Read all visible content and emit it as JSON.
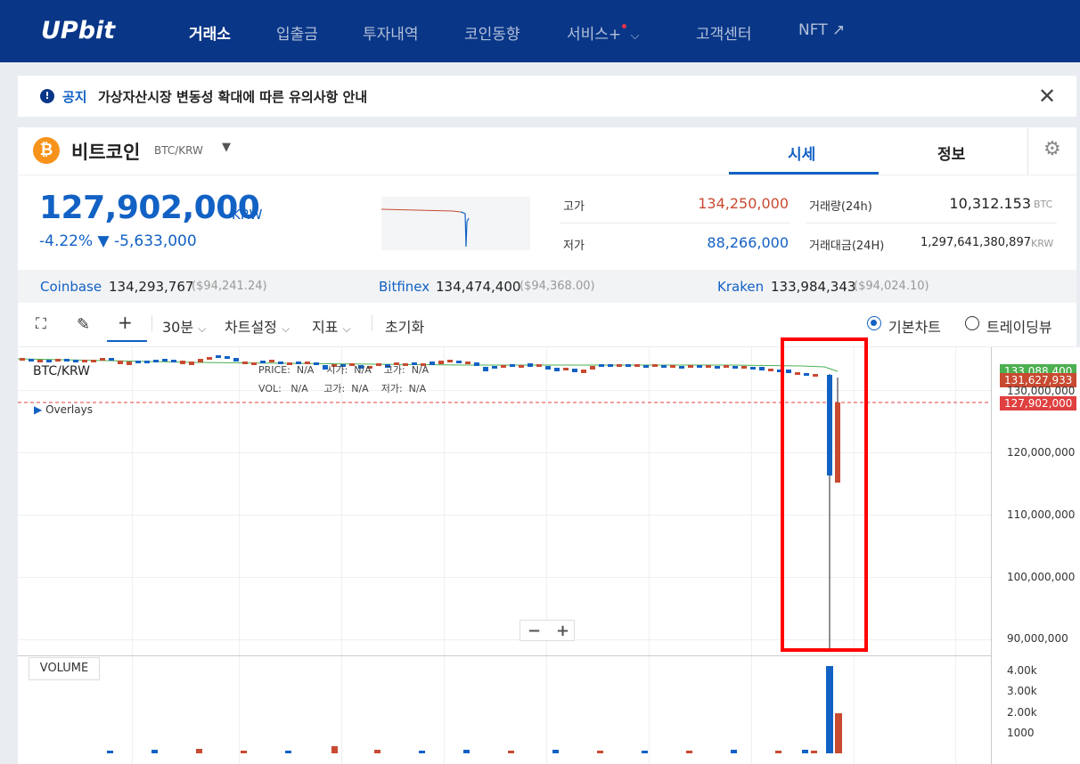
{
  "nav": {
    "logo": "UPbit",
    "items": [
      "거래소",
      "입출금",
      "투자내역",
      "코인동향",
      "서비스+",
      "고객센터",
      "NFT ↗"
    ]
  },
  "notice": {
    "label": "공지",
    "text": "가상자산시장 변동성 확대에 따른 유의사항 안내",
    "close": "✕"
  },
  "coin": {
    "name": "비트코인",
    "pair": "BTC/KRW",
    "tabs": [
      "시세",
      "정보"
    ],
    "price": "127,902,000",
    "unit": "KRW",
    "change_pct": "-4.22%",
    "change_amt": "▼ -5,633,000",
    "stats": {
      "high_label": "고가",
      "high_value": "134,250,000",
      "low_label": "저가",
      "low_value": "88,266,000",
      "vol_label": "거래량(24h)",
      "vol_value": "10,312.153",
      "vol_unit": "BTC",
      "amt_label": "거래대금(24H)",
      "amt_value": "1,297,641,380,897",
      "amt_unit": "KRW"
    }
  },
  "exchanges": [
    {
      "name": "Coinbase",
      "value": "134,293,767",
      "usd": "($94,241.24)"
    },
    {
      "name": "Bitfinex",
      "value": "134,474,400",
      "usd": "($94,368.00)"
    },
    {
      "name": "Kraken",
      "value": "133,984,343",
      "usd": "($94,024.10)"
    }
  ],
  "toolbar": {
    "interval": "30분",
    "chart_settings": "차트설정",
    "indicators": "지표",
    "reset": "초기화",
    "basic_chart": "기본차트",
    "trading_view": "트레이딩뷰"
  },
  "chart": {
    "pair": "BTC/KRW",
    "overlays": "Overlays",
    "legend": {
      "price": "PRICE:",
      "open": "시가",
      "high": "고가",
      "low": "저가",
      "vol": "VOL:",
      "na": "N/A"
    },
    "y_ticks": [
      "130,000,000",
      "120,000,000",
      "110,000,000",
      "100,000,000",
      "90,000,000"
    ],
    "tags": [
      "133,088,400",
      "131,627,933",
      "127,902,000"
    ],
    "volume_label": "VOLUME",
    "vol_ticks": [
      "4.00k",
      "3.00k",
      "2.00k",
      "1000"
    ],
    "zoom_minus": "−",
    "zoom_plus": "+",
    "colors": {
      "up": "#c84a31",
      "down": "#1261c4",
      "current": "#e04040",
      "ma": "#4caf50"
    }
  }
}
